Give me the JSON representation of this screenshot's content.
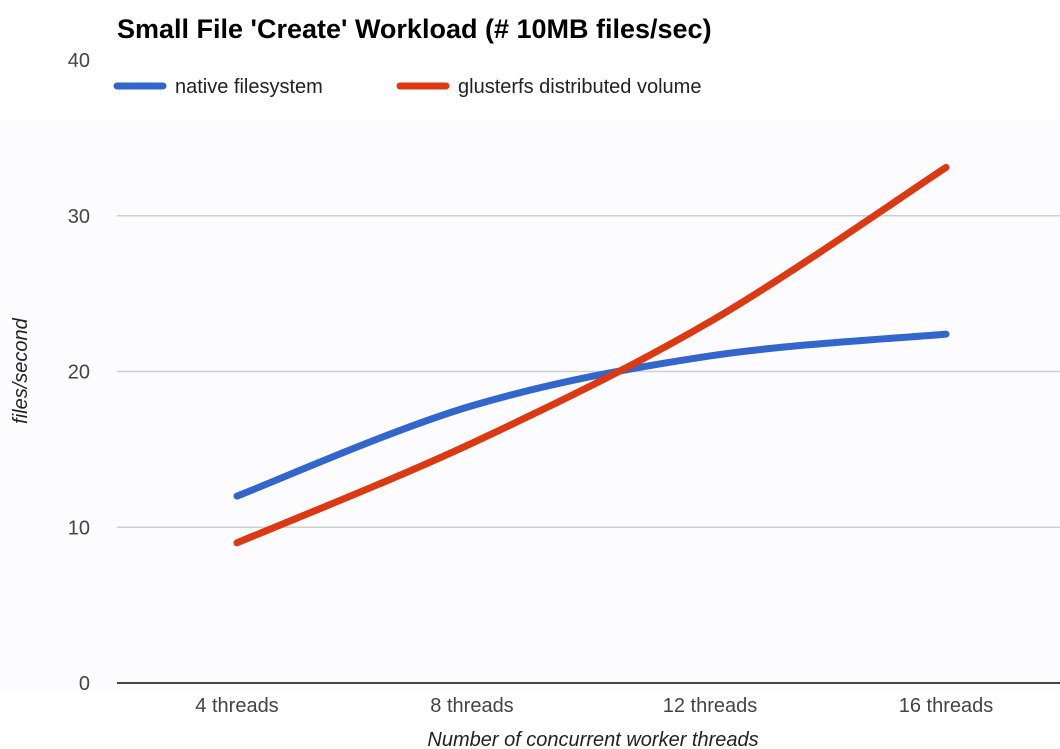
{
  "chart_data": {
    "type": "line",
    "title": "Small File 'Create' Workload (# 10MB files/sec)",
    "xlabel": "Number of concurrent worker threads",
    "ylabel": "files/second",
    "categories": [
      "4 threads",
      "8 threads",
      "12 threads",
      "16 threads"
    ],
    "ylim": [
      0,
      40
    ],
    "yticks": [
      0,
      10,
      20,
      30,
      40
    ],
    "grid": true,
    "legend_position": "top",
    "series": [
      {
        "name": "native filesystem",
        "color": "#3366cc",
        "values": [
          12,
          17.8,
          21,
          22.4
        ]
      },
      {
        "name": "glusterfs distributed volume",
        "color": "#dc3912",
        "values": [
          9,
          15.4,
          23.2,
          33.1
        ]
      }
    ]
  }
}
